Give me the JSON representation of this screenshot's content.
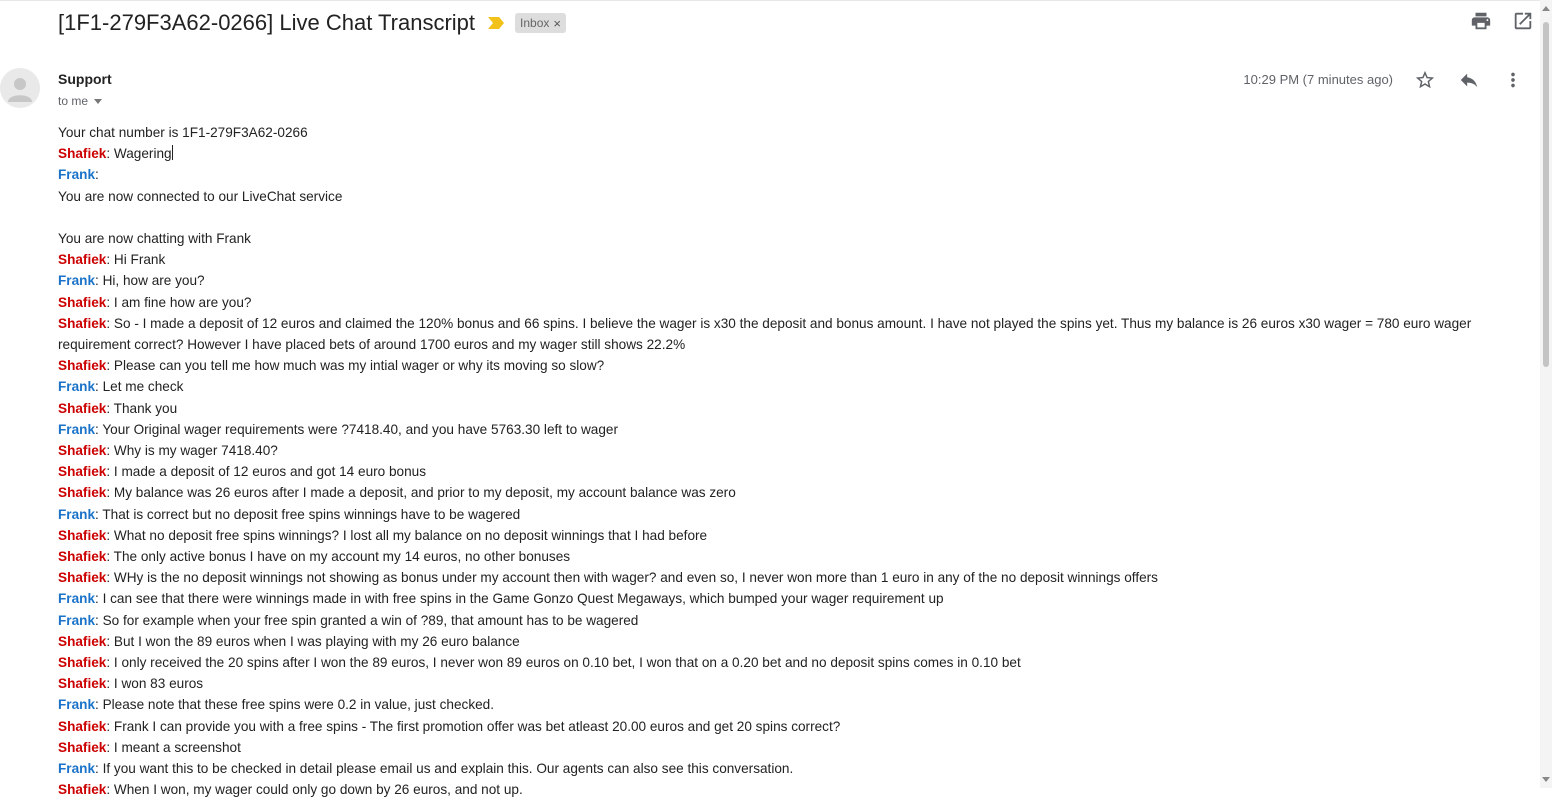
{
  "email": {
    "subject": "[1F1-279F3A62-0266] Live Chat Transcript",
    "label": "Inbox",
    "label_close": "×",
    "sender": "Support",
    "recipient": "to me",
    "timestamp": "10:29 PM (7 minutes ago)"
  },
  "icons": {
    "importance": "importance-marker-icon",
    "print": "print-icon",
    "open_new_window": "open-new-window-icon",
    "avatar": "person-avatar-icon",
    "star": "star-icon",
    "reply": "reply-icon",
    "more": "more-vert-icon"
  },
  "colors": {
    "shafiek": "#cc0000",
    "frank": "#1a73c8",
    "label_bg": "#dddddd"
  },
  "transcript": [
    {
      "speaker": "",
      "text": "Your chat number is 1F1-279F3A62-0266"
    },
    {
      "speaker": "Shafiek",
      "text": ": Wagering"
    },
    {
      "speaker": "Frank",
      "text": ":"
    },
    {
      "speaker": "",
      "text": "You are now connected to our LiveChat service"
    },
    {
      "speaker": "",
      "text": ""
    },
    {
      "speaker": "",
      "text": "You are now chatting with Frank"
    },
    {
      "speaker": "Shafiek",
      "text": ": Hi Frank"
    },
    {
      "speaker": "Frank",
      "text": ": Hi, how are you?"
    },
    {
      "speaker": "Shafiek",
      "text": ": I am fine how are you?"
    },
    {
      "speaker": "Shafiek",
      "text": ": So - I made a deposit of 12 euros and claimed the 120% bonus and 66 spins. I believe the wager is x30 the deposit and bonus amount. I have not played the spins yet. Thus my balance is 26 euros x30 wager = 780 euro wager requirement correct? However I have placed bets of around 1700 euros and my wager still shows 22.2%"
    },
    {
      "speaker": "Shafiek",
      "text": ": Please can you tell me how much was my intial wager or why its moving so slow?"
    },
    {
      "speaker": "Frank",
      "text": ": Let me check"
    },
    {
      "speaker": "Shafiek",
      "text": ": Thank you"
    },
    {
      "speaker": "Frank",
      "text": ": Your Original wager requirements were ?7418.40, and you have 5763.30 left to wager"
    },
    {
      "speaker": "Shafiek",
      "text": ": Why is my wager 7418.40?"
    },
    {
      "speaker": "Shafiek",
      "text": ": I made a deposit of 12 euros and got 14 euro bonus"
    },
    {
      "speaker": "Shafiek",
      "text": ": My balance was 26 euros after I made a deposit, and prior to my deposit, my account balance was zero"
    },
    {
      "speaker": "Frank",
      "text": ": That is correct but no deposit free spins winnings have to be wagered"
    },
    {
      "speaker": "Shafiek",
      "text": ": What no deposit free spins winnings? I lost all my balance on no deposit winnings that I had before"
    },
    {
      "speaker": "Shafiek",
      "text": ": The only active bonus I have on my account my 14 euros, no other bonuses"
    },
    {
      "speaker": "Shafiek",
      "text": ": WHy is the no deposit winnings not showing as bonus under my account then with wager? and even so, I never won more than 1 euro in any of the no deposit winnings offers"
    },
    {
      "speaker": "Frank",
      "text": ": I can see that there were winnings made in with free spins in the Game Gonzo Quest Megaways, which bumped your wager requirement up"
    },
    {
      "speaker": "Frank",
      "text": ": So for example when your free spin granted a win of ?89, that amount has to be wagered"
    },
    {
      "speaker": "Shafiek",
      "text": ": But I won the 89 euros when I was playing with my 26 euro balance"
    },
    {
      "speaker": "Shafiek",
      "text": ": I only received the 20 spins after I won the 89 euros, I never won 89 euros on 0.10 bet, I won that on a 0.20 bet and no deposit spins comes in 0.10 bet"
    },
    {
      "speaker": "Shafiek",
      "text": ": I won 83 euros"
    },
    {
      "speaker": "Frank",
      "text": ": Please note that these free spins were 0.2 in value, just checked."
    },
    {
      "speaker": "Shafiek",
      "text": ": Frank I can provide you with a free spins - The first promotion offer was bet atleast 20.00 euros and get 20 spins correct?"
    },
    {
      "speaker": "Shafiek",
      "text": ": I meant a screenshot"
    },
    {
      "speaker": "Frank",
      "text": ": If you want this to be checked in detail please email us and explain this. Our agents can also see this conversation."
    },
    {
      "speaker": "Shafiek",
      "text": ": When I won, my wager could only go down by 26 euros, and not up."
    }
  ]
}
